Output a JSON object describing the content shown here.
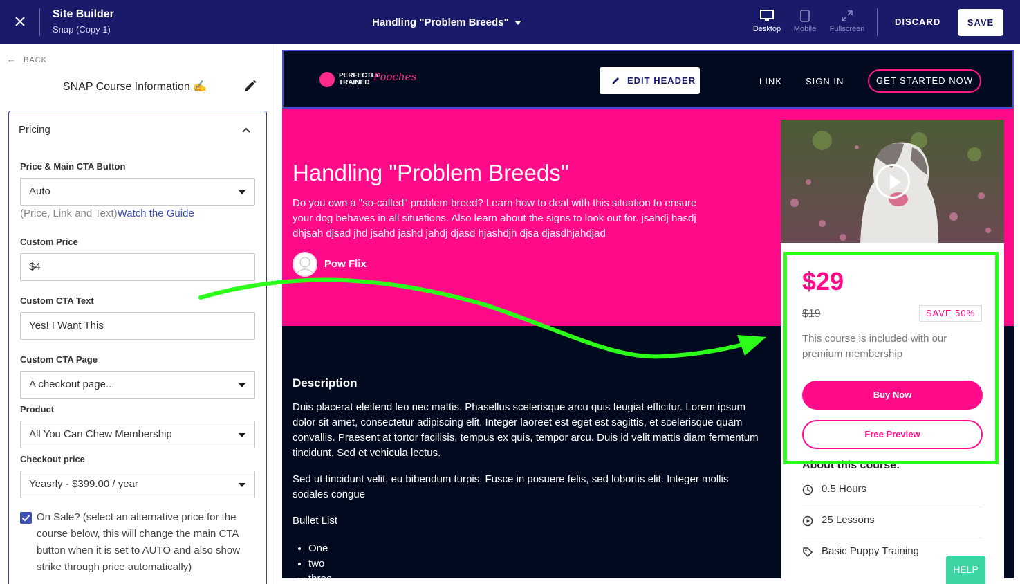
{
  "topbar": {
    "title": "Site Builder",
    "subtitle": "Snap (Copy 1)",
    "page_selector": "Handling \"Problem Breeds\"",
    "views": {
      "desktop": "Desktop",
      "mobile": "Mobile",
      "fullscreen": "Fullscreen"
    },
    "active_view": "Desktop",
    "discard_label": "DISCARD",
    "save_label": "SAVE",
    "bg_color": "#1a1a6b"
  },
  "left_panel": {
    "back_label": "BACK",
    "title": "SNAP Course Information ✍️",
    "section_title": "Pricing",
    "price_cta": {
      "label": "Price & Main CTA Button",
      "value": "Auto"
    },
    "hint_text": "(Price, Link and Text)",
    "hint_link": "Watch the Guide",
    "custom_price": {
      "label": "Custom Price",
      "value": "$4"
    },
    "custom_cta_text": {
      "label": "Custom CTA Text",
      "value": "Yes! I Want This"
    },
    "custom_cta_page": {
      "label": "Custom CTA Page",
      "value": "A checkout page..."
    },
    "product": {
      "label": "Product",
      "value": "All You Can Chew Membership"
    },
    "checkout_price": {
      "label": "Checkout price",
      "value": "Yeasrly - $399.00 / year"
    },
    "on_sale": {
      "checked": true,
      "text": "On Sale? (select an alternative price for the course below, this will change the main CTA button when it is set to AUTO and also show strike through price automatically)"
    }
  },
  "preview": {
    "logo_text_1": "PERFECTLY",
    "logo_text_2": "TRAINED",
    "logo_script": "Pooches",
    "edit_header_label": "EDIT HEADER",
    "nav_link": "LINK",
    "nav_signin": "SIGN IN",
    "nav_cta": "GET STARTED NOW",
    "hero_title": "Handling \"Problem Breeds\"",
    "hero_desc": "Do you own a \"so-called\" problem breed? Learn how to deal with this situation to ensure your dog behaves in all situations. Also learn about the signs to look out for. jsahdj hasdj dhjsah djsad jhd jsahd jashd jahdj djasd hjashdjh djsa djasdhjahdjad",
    "author": "Pow Flix",
    "description_heading": "Description",
    "description_p1": "Duis placerat eleifend leo nec mattis. Phasellus scelerisque arcu quis feugiat efficitur. Lorem ipsum dolor sit amet, consectetur adipiscing elit. Integer laoreet est eget est sagittis, et scelerisque quam convallis. Praesent at tortor facilisis, tempus ex quis, tempor arcu. Duis id velit mattis diam fermentum tincidunt. Sed et vehicula lectus.",
    "description_p2": "Sed ut tincidunt velit, eu bibendum turpis. Fusce in posuere felis, sed lobortis elit. Integer mollis sodales congue",
    "bullet_title": "Bullet List",
    "bullets": [
      "One",
      "two",
      "three"
    ],
    "accent_color": "#ff0b8a"
  },
  "course_card": {
    "price": "$29",
    "old_price": "$19",
    "save_badge": "SAVE 50%",
    "included_text": "This course is included with our premium membership",
    "buy_label": "Buy Now",
    "preview_label": "Free Preview",
    "about_heading": "About this course:",
    "meta": [
      {
        "icon": "clock-icon",
        "text": "0.5 Hours"
      },
      {
        "icon": "play-circle-icon",
        "text": "25 Lessons"
      },
      {
        "icon": "tag-icon",
        "text": "Basic Puppy Training"
      }
    ]
  },
  "help_label": "HELP",
  "annotation_color": "#2bff1a"
}
